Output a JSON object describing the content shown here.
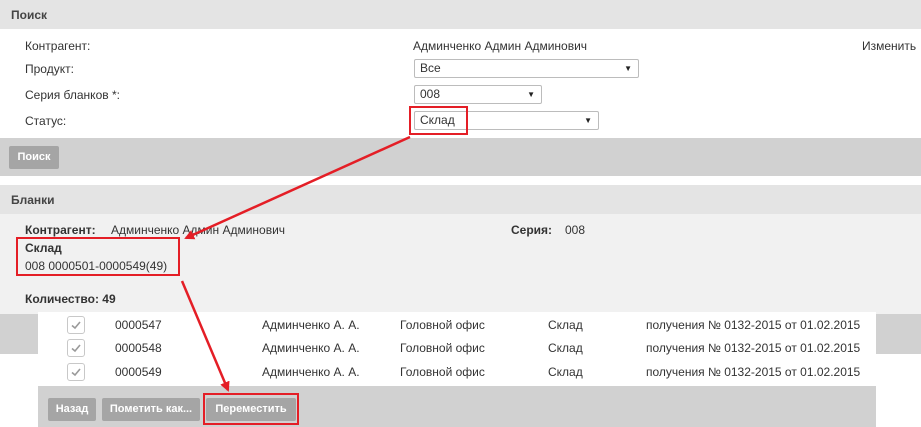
{
  "search": {
    "title": "Поиск",
    "contractor_label": "Контрагент:",
    "contractor_value": "Админченко Админ Админович",
    "change_link": "Изменить",
    "product_label": "Продукт:",
    "product_value": "Все",
    "series_label": "Серия бланков *:",
    "series_value": "008",
    "status_label": "Статус:",
    "status_value": "Склад",
    "search_button": "Поиск"
  },
  "blanks": {
    "title": "Бланки",
    "contractor_label": "Контрагент:",
    "contractor_value": "Админченко Админ Админович",
    "series_label": "Серия:",
    "series_value": "008",
    "status_heading": "Склад",
    "range": "008 0000501-0000549(49)",
    "count_label": "Количество: 49"
  },
  "table": {
    "rows": [
      {
        "number": "0000547",
        "person": "Админченко А. А.",
        "office": "Головной офис",
        "status": "Склад",
        "doc": "получения № 0132-2015 от 01.02.2015"
      },
      {
        "number": "0000548",
        "person": "Админченко А. А.",
        "office": "Головной офис",
        "status": "Склад",
        "doc": "получения № 0132-2015 от 01.02.2015"
      },
      {
        "number": "0000549",
        "person": "Админченко А. А.",
        "office": "Головной офис",
        "status": "Склад",
        "doc": "получения № 0132-2015 от 01.02.2015"
      }
    ]
  },
  "actions": {
    "back": "Назад",
    "mark_as": "Пометить как...",
    "move": "Переместить"
  },
  "colors": {
    "highlight": "#e41e26",
    "button": "#a5a5a5",
    "header_bg": "#e4e4e4",
    "band": "#d1d1d1"
  }
}
